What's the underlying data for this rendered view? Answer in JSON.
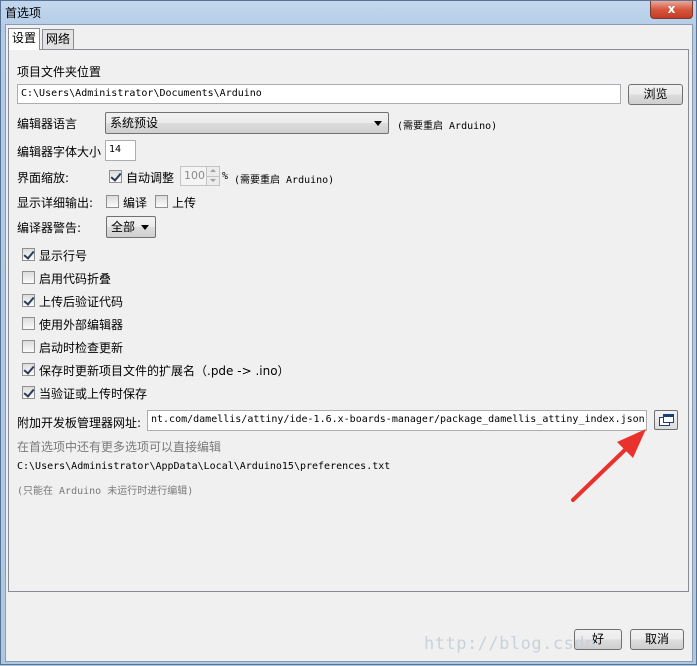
{
  "window": {
    "title": "首选项",
    "close_glyph": "x"
  },
  "tabs": [
    {
      "label": "设置",
      "active": true
    },
    {
      "label": "网络",
      "active": false
    }
  ],
  "sketchbook": {
    "label": "项目文件夹位置",
    "path": "C:\\Users\\Administrator\\Documents\\Arduino",
    "browse_label": "浏览"
  },
  "editor_language": {
    "label": "编辑器语言",
    "value": "系统预设",
    "note": "(需要重启 Arduino)"
  },
  "editor_font_size": {
    "label": "编辑器字体大小",
    "value": "14"
  },
  "interface_scale": {
    "label": "界面缩放:",
    "auto_label": "自动调整",
    "auto_checked": true,
    "value": "100",
    "unit": "%",
    "note": "(需要重启 Arduino)"
  },
  "verbose_output": {
    "label": "显示详细输出:",
    "compile_label": "编译",
    "compile_checked": false,
    "upload_label": "上传",
    "upload_checked": false
  },
  "compiler_warnings": {
    "label": "编译器警告:",
    "value": "全部"
  },
  "options": [
    {
      "label": "显示行号",
      "checked": true
    },
    {
      "label": "启用代码折叠",
      "checked": false
    },
    {
      "label": "上传后验证代码",
      "checked": true
    },
    {
      "label": "使用外部编辑器",
      "checked": false
    },
    {
      "label": "启动时检查更新",
      "checked": false
    },
    {
      "label": "保存时更新项目文件的扩展名（.pde -> .ino）",
      "checked": true
    },
    {
      "label": "当验证或上传时保存",
      "checked": true
    }
  ],
  "boards_manager": {
    "label": "附加开发板管理器网址:",
    "url": "nt.com/damellis/attiny/ide-1.6.x-boards-manager/package_damellis_attiny_index.json",
    "button_icon": "window-list-icon"
  },
  "more_prefs_note": "在首选项中还有更多选项可以直接编辑",
  "prefs_path": "C:\\Users\\Administrator\\AppData\\Local\\Arduino15\\preferences.txt",
  "edit_note": "(只能在 Arduino 未运行时进行编辑)",
  "footer": {
    "ok_label": "好",
    "cancel_label": "取消"
  },
  "watermark": "http://blog.csdn",
  "annotation": {
    "color": "#e8322b"
  }
}
